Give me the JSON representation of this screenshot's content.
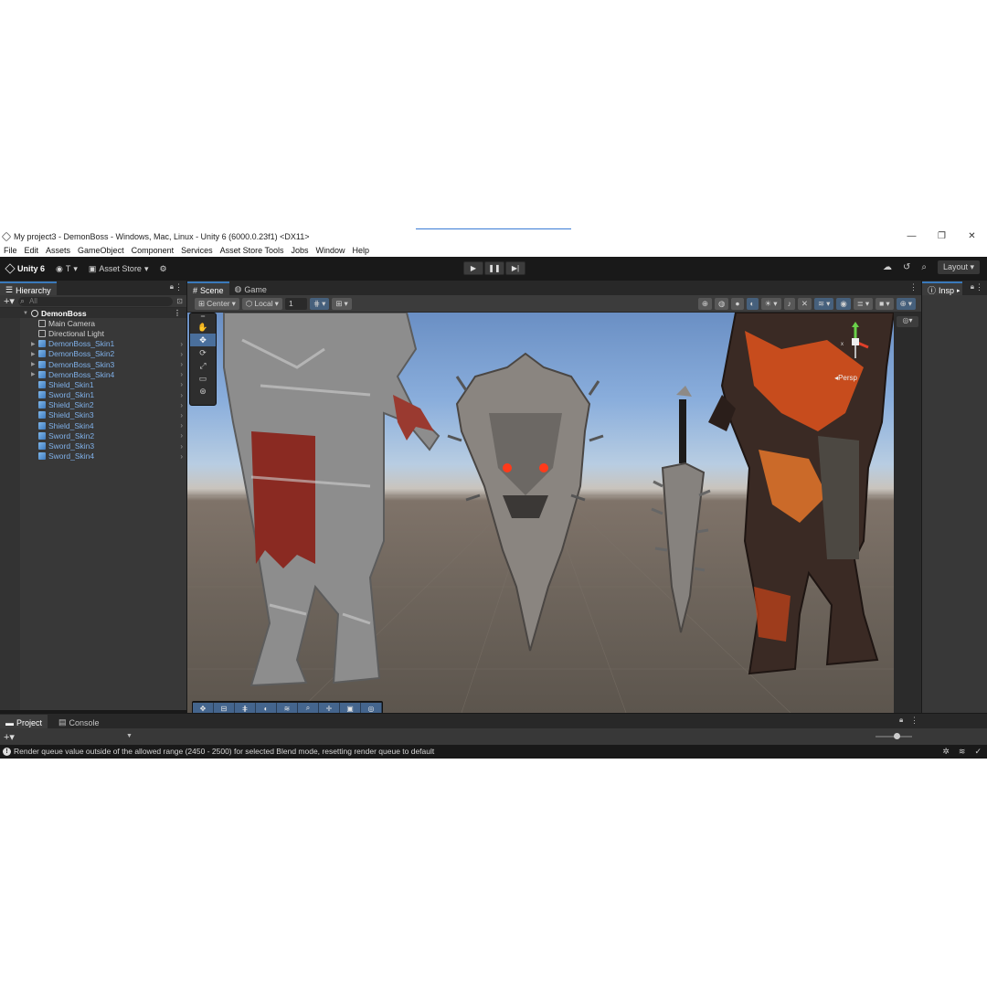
{
  "window": {
    "title": "My project3 - DemonBoss - Windows, Mac, Linux - Unity 6 (6000.0.23f1) <DX11>",
    "controls": [
      "—",
      "❐",
      "✕"
    ]
  },
  "menu": [
    "File",
    "Edit",
    "Assets",
    "GameObject",
    "Component",
    "Services",
    "Asset Store Tools",
    "Jobs",
    "Window",
    "Help"
  ],
  "toolbar": {
    "unity_label": "Unity 6",
    "account_label": "T",
    "asset_store_label": "Asset Store",
    "layout_label": "Layout"
  },
  "hierarchy": {
    "tab_label": "Hierarchy",
    "search_placeholder": "All",
    "scene_name": "DemonBoss",
    "items": [
      {
        "label": "Main Camera",
        "type": "object"
      },
      {
        "label": "Directional Light",
        "type": "object"
      },
      {
        "label": "DemonBoss_Skin1",
        "type": "prefab-expandable"
      },
      {
        "label": "DemonBoss_Skin2",
        "type": "prefab-expandable"
      },
      {
        "label": "DemonBoss_Skin3",
        "type": "prefab-expandable"
      },
      {
        "label": "DemonBoss_Skin4",
        "type": "prefab-expandable"
      },
      {
        "label": "Shield_Skin1",
        "type": "prefab"
      },
      {
        "label": "Sword_Skin1",
        "type": "prefab"
      },
      {
        "label": "Shield_Skin2",
        "type": "prefab"
      },
      {
        "label": "Shield_Skin3",
        "type": "prefab"
      },
      {
        "label": "Shield_Skin4",
        "type": "prefab"
      },
      {
        "label": "Sword_Skin2",
        "type": "prefab"
      },
      {
        "label": "Sword_Skin3",
        "type": "prefab"
      },
      {
        "label": "Sword_Skin4",
        "type": "prefab"
      }
    ]
  },
  "scene_view": {
    "tabs": [
      "Scene",
      "Game"
    ],
    "pivot_label": "Center",
    "space_label": "Local",
    "grid_value": "1",
    "persp_label": "Persp"
  },
  "inspector": {
    "tab_label": "Insp"
  },
  "bottom": {
    "tabs": [
      "Project",
      "Console"
    ]
  },
  "status": {
    "message": "Render queue value outside of the allowed range (2450 - 2500) for selected Blend mode, resetting render queue to default"
  },
  "colors": {
    "accent": "#3a79bb",
    "prefab_text": "#7fb0e8",
    "sky_top": "#6a8fc4",
    "ground": "#6e655c"
  }
}
